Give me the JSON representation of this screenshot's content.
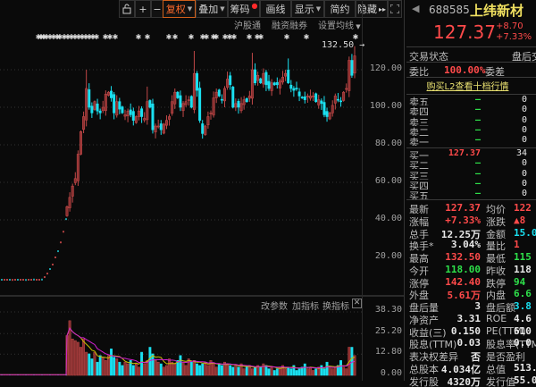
{
  "toolbar": {
    "buttons": [
      {
        "label": "复权",
        "active": true,
        "caret": true
      },
      {
        "label": "叠加",
        "caret": true
      },
      {
        "label": "筹码",
        "dot": true
      },
      {
        "label": "画线"
      },
      {
        "label": "显示",
        "caret": true
      },
      {
        "label": "简约"
      },
      {
        "label": "隐藏",
        "arrows": "▸▸"
      }
    ],
    "zoom_in": "+",
    "zoom_out": "−"
  },
  "subbar": {
    "hk_connect": "沪股通",
    "margin": "融资融券",
    "ma_settings": "设置均线"
  },
  "price_axis": [
    "120.00",
    "100.00",
    "80.00",
    "60.00",
    "40.00",
    "20.00"
  ],
  "high_marker": "132.50",
  "volume_toolbar": {
    "change_params": "改参数",
    "add_indicator": "加指标",
    "switch_indicator": "换指标"
  },
  "volume_axis": [
    "38.30",
    "25.20",
    "12.80",
    "0.00"
  ],
  "colors": {
    "up": "#ff4a4a",
    "down": "#1ae0f0",
    "bg": "#0a0a0a",
    "accent": "#ff6a2a",
    "name": "#f0e060"
  },
  "chart": {
    "early_prices": [
      8.1,
      8.1,
      8.1,
      8.1,
      8.0,
      8.1,
      8.1,
      8.1,
      8.1,
      8.0,
      8.1,
      8.1,
      8.2,
      8.1,
      8.1,
      8.2,
      9.5,
      11.4,
      13.8,
      16.2,
      20.0,
      23.3,
      28.0,
      33.7,
      40.4
    ],
    "closes": [
      47,
      52,
      58,
      62,
      75,
      87,
      95,
      110,
      100,
      97,
      103,
      98,
      97,
      100,
      107,
      108,
      105,
      97,
      103,
      99,
      97,
      96,
      98,
      96,
      93,
      95,
      98,
      95,
      94,
      103,
      100,
      88,
      90,
      90,
      88,
      91,
      93,
      95,
      103,
      108,
      105,
      100,
      102,
      103,
      104,
      100,
      118,
      109,
      93,
      86,
      90,
      95,
      97,
      105,
      108,
      106,
      104,
      110,
      115,
      112,
      100,
      102,
      100,
      102,
      104,
      103,
      106,
      120,
      113,
      117,
      113,
      118,
      112,
      110,
      113,
      112,
      112,
      114,
      116,
      118,
      113,
      110,
      109,
      110,
      106,
      105,
      104,
      106,
      106,
      106,
      103,
      104,
      102,
      96,
      95,
      97,
      101,
      106,
      104,
      103,
      108,
      110,
      125,
      117,
      127.37
    ],
    "spike_highs": {
      "7": 120,
      "29": 111,
      "46": 130,
      "58": 119,
      "67": 129,
      "80": 126,
      "102": 127,
      "104": 132.5
    },
    "volumes": [
      24,
      33,
      22,
      21,
      20,
      17,
      22,
      14,
      13,
      10,
      14,
      8,
      12,
      11,
      9,
      12,
      16,
      11,
      10,
      8,
      6,
      8,
      7,
      9,
      6,
      7,
      5,
      14,
      7,
      9,
      17,
      13,
      9,
      8,
      7,
      5,
      6,
      10,
      8,
      7,
      9,
      12,
      8,
      6,
      10,
      8,
      9,
      7,
      6,
      7,
      8,
      6,
      9,
      7,
      5,
      7,
      6,
      8,
      7,
      6,
      5,
      6,
      5,
      7,
      4,
      5,
      6,
      4,
      5,
      6,
      5,
      7,
      6,
      4,
      5,
      3,
      4,
      5,
      6,
      4,
      5,
      4,
      6,
      3,
      4,
      5,
      7,
      4,
      5,
      3,
      4,
      5,
      6,
      4,
      8,
      5,
      4,
      5,
      6,
      9,
      5,
      4,
      17,
      17,
      12
    ]
  },
  "quote": {
    "code": "688585",
    "name": "上纬新材",
    "price": "127.37",
    "change": "+8.70",
    "change_pct": "+7.33%",
    "status_label": "交易状态",
    "status_value": "盘后交",
    "ratio_label": "委比",
    "ratio_value": "100.00%",
    "diff_label": "委差",
    "l2_link": "购买L2查看十档行情"
  },
  "order_book": {
    "asks": [
      {
        "label": "卖五",
        "price": "—",
        "vol": "0"
      },
      {
        "label": "卖四",
        "price": "—",
        "vol": "0"
      },
      {
        "label": "卖三",
        "price": "—",
        "vol": "0"
      },
      {
        "label": "卖二",
        "price": "—",
        "vol": "0"
      },
      {
        "label": "卖一",
        "price": "—",
        "vol": "0"
      }
    ],
    "bids": [
      {
        "label": "买一",
        "price": "127.37",
        "vol": "34"
      },
      {
        "label": "买二",
        "price": "—",
        "vol": "0"
      },
      {
        "label": "买三",
        "price": "—",
        "vol": "0"
      },
      {
        "label": "买四",
        "price": "—",
        "vol": "0"
      },
      {
        "label": "买五",
        "price": "—",
        "vol": "0"
      }
    ]
  },
  "stats": [
    {
      "l1": "最新",
      "v1": "127.37",
      "c1": "red",
      "l2": "均价",
      "v2": "122",
      "c2": "red"
    },
    {
      "l1": "涨幅",
      "v1": "+7.33%",
      "c1": "red",
      "l2": "涨跌",
      "v2": "▲8",
      "c2": "red"
    },
    {
      "l1": "总手",
      "v1": "12.25万",
      "c1": "white",
      "l2": "金额",
      "v2": "15.0",
      "c2": "cyan"
    },
    {
      "l1": "换手*",
      "v1": "3.04%",
      "c1": "white",
      "l2": "量比",
      "v2": "1",
      "c2": "red"
    },
    {
      "l1": "最高",
      "v1": "132.50",
      "c1": "red",
      "l2": "最低",
      "v2": "115",
      "c2": "green"
    },
    {
      "l1": "今开",
      "v1": "118.00",
      "c1": "green",
      "l2": "昨收",
      "v2": "118",
      "c2": "white"
    },
    {
      "l1": "涨停",
      "v1": "142.40",
      "c1": "red",
      "l2": "跌停",
      "v2": "94",
      "c2": "green"
    },
    {
      "l1": "外盘",
      "v1": "5.61万",
      "c1": "red",
      "l2": "内盘",
      "v2": "6.6",
      "c2": "green"
    },
    {
      "l1": "盘后量",
      "v1": "3",
      "c1": "white",
      "l2": "盘后额",
      "v2": "3.8",
      "c2": "cyan"
    },
    {
      "l1": "净资产",
      "v1": "3.31",
      "c1": "white",
      "l2": "ROE",
      "v2": "4.6",
      "c2": "white"
    },
    {
      "l1": "收益(三)",
      "v1": "0.150",
      "c1": "white",
      "l2": "PE(TTM)",
      "v2": "610",
      "c2": "white"
    },
    {
      "l1": "股息(TTM)",
      "v1": "0.03",
      "c1": "white",
      "l2": "股息率(TTM)",
      "v2": "0.0",
      "c2": "white"
    },
    {
      "l1": "表决权差异",
      "v1": "否",
      "c1": "white",
      "l2": "是否盈利",
      "v2": "",
      "c2": "white"
    },
    {
      "l1": "总股本",
      "v1": "4.034亿",
      "c1": "white",
      "l2": "总值",
      "v2": "513.",
      "c2": "white"
    },
    {
      "l1": "发行股",
      "v1": "4320万",
      "c1": "white",
      "l2": "发行值",
      "v2": "55.0",
      "c2": "white"
    }
  ]
}
